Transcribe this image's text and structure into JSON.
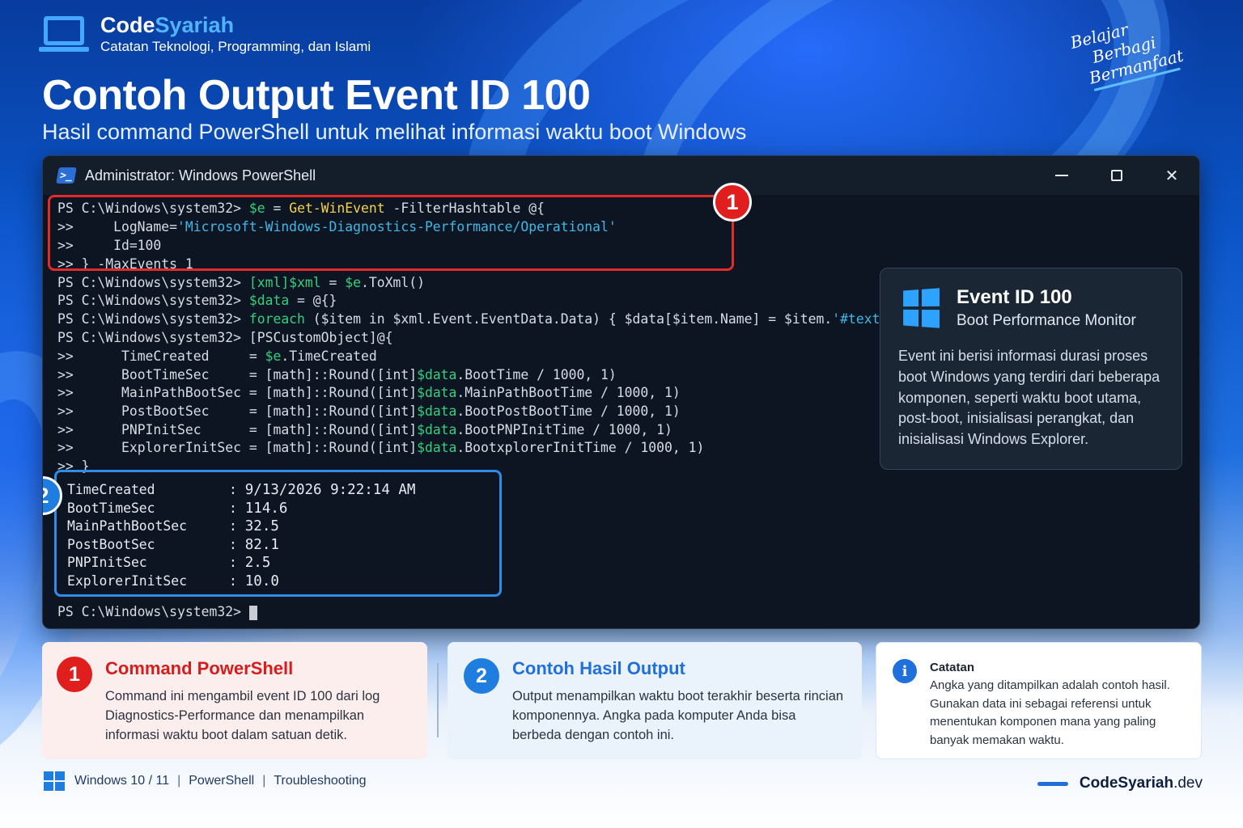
{
  "brand": {
    "name_part1": "Code",
    "name_part2": "Syariah",
    "tagline": "Catatan Teknologi, Programming, dan Islami"
  },
  "motto": [
    "Belajar",
    "Berbagi",
    "Bermanfaat"
  ],
  "title": "Contoh Output Event ID 100",
  "subtitle": "Hasil command PowerShell untuk melihat informasi waktu boot Windows",
  "window": {
    "title": "Administrator: Windows PowerShell",
    "controls": {
      "minimize": "",
      "maximize": "",
      "close": "✕"
    }
  },
  "terminal": {
    "prompt": "PS C:\\Windows\\system32> ",
    "cont": ">> ",
    "lines": [
      {
        "pre": "PS C:\\Windows\\system32> ",
        "parts": [
          [
            "var",
            "$e"
          ],
          [
            "txt",
            " = "
          ],
          [
            "cmd",
            "Get-WinEvent"
          ],
          [
            "txt",
            " -FilterHashtable @{"
          ]
        ]
      },
      {
        "pre": ">>     ",
        "parts": [
          [
            "txt",
            "LogName="
          ],
          [
            "str",
            "'Microsoft-Windows-Diagnostics-Performance/Operational'"
          ]
        ]
      },
      {
        "pre": ">>     ",
        "parts": [
          [
            "txt",
            "Id=100"
          ]
        ]
      },
      {
        "pre": ">> ",
        "parts": [
          [
            "txt",
            "} -MaxEvents 1"
          ]
        ]
      },
      {
        "pre": "PS C:\\Windows\\system32> ",
        "parts": [
          [
            "var",
            "[xml]$xml"
          ],
          [
            "txt",
            " = "
          ],
          [
            "var",
            "$e"
          ],
          [
            "txt",
            ".ToXml()"
          ]
        ]
      },
      {
        "pre": "PS C:\\Windows\\system32> ",
        "parts": [
          [
            "var",
            "$data"
          ],
          [
            "txt",
            " = @{}"
          ]
        ]
      },
      {
        "pre": "PS C:\\Windows\\system32> ",
        "parts": [
          [
            "kw",
            "foreach"
          ],
          [
            "txt",
            " ($item in $xml.Event.EventData.Data) { $data[$item.Name] = $item."
          ],
          [
            "str",
            "'#text'"
          ],
          [
            "txt",
            " }"
          ]
        ]
      },
      {
        "pre": "PS C:\\Windows\\system32> ",
        "parts": [
          [
            "txt",
            "[PSCustomObject]@{"
          ]
        ]
      },
      {
        "pre": ">>      ",
        "parts": [
          [
            "txt",
            "TimeCreated     = "
          ],
          [
            "var",
            "$e"
          ],
          [
            "txt",
            ".TimeCreated"
          ]
        ]
      },
      {
        "pre": ">>      ",
        "parts": [
          [
            "txt",
            "BootTimeSec     = [math]::Round([int]"
          ],
          [
            "var",
            "$data"
          ],
          [
            "txt",
            ".BootTime / 1000, 1)"
          ]
        ]
      },
      {
        "pre": ">>      ",
        "parts": [
          [
            "txt",
            "MainPathBootSec = [math]::Round([int]"
          ],
          [
            "var",
            "$data"
          ],
          [
            "txt",
            ".MainPathBootTime / 1000, 1)"
          ]
        ]
      },
      {
        "pre": ">>      ",
        "parts": [
          [
            "txt",
            "PostBootSec     = [math]::Round([int]"
          ],
          [
            "var",
            "$data"
          ],
          [
            "txt",
            ".BootPostBootTime / 1000, 1)"
          ]
        ]
      },
      {
        "pre": ">>      ",
        "parts": [
          [
            "txt",
            "PNPInitSec      = [math]::Round([int]"
          ],
          [
            "var",
            "$data"
          ],
          [
            "txt",
            ".BootPNPInitTime / 1000, 1)"
          ]
        ]
      },
      {
        "pre": ">>      ",
        "parts": [
          [
            "txt",
            "ExplorerInitSec = [math]::Round([int]"
          ],
          [
            "var",
            "$data"
          ],
          [
            "txt",
            ".BootxplorerInitTime / 1000, 1)"
          ]
        ]
      },
      {
        "pre": ">> ",
        "parts": [
          [
            "txt",
            "}"
          ]
        ]
      }
    ],
    "output": [
      {
        "key": "TimeCreated",
        "value": "9/13/2026 9:22:14 AM"
      },
      {
        "key": "BootTimeSec",
        "value": "114.6"
      },
      {
        "key": "MainPathBootSec",
        "value": "32.5"
      },
      {
        "key": "PostBootSec",
        "value": "82.1"
      },
      {
        "key": "PNPInitSec",
        "value": "2.5"
      },
      {
        "key": "ExplorerInitSec",
        "value": "10.0"
      }
    ],
    "separator": ":",
    "last_prompt": "PS C:\\Windows\\system32> "
  },
  "badges": {
    "one": "1",
    "two": "2"
  },
  "info_card": {
    "title": "Event ID 100",
    "subtitle": "Boot Performance Monitor",
    "body": "Event ini berisi informasi durasi proses boot Windows yang terdiri dari beberapa komponen, seperti waktu boot utama, post-boot, inisialisasi perangkat, dan inisialisasi Windows Explorer."
  },
  "cards": [
    {
      "number": "1",
      "title": "Command PowerShell",
      "body": "Command ini mengambil event ID 100 dari log Diagnostics-Performance dan menampilkan informasi waktu boot dalam satuan detik."
    },
    {
      "number": "2",
      "title": "Contoh Hasil Output",
      "body": "Output menampilkan waktu boot terakhir beserta rincian komponennya. Angka pada komputer Anda bisa berbeda dengan contoh ini."
    }
  ],
  "note": {
    "icon": "i",
    "title": "Catatan",
    "body": "Angka yang ditampilkan adalah contoh hasil. Gunakan data ini sebagai referensi untuk menentukan komponen mana yang paling banyak memakan waktu."
  },
  "footer": {
    "tags": [
      "Windows 10 / 11",
      "PowerShell",
      "Troubleshooting"
    ],
    "pipe": "|",
    "site_name": "CodeSyariah",
    "site_tld": ".dev"
  },
  "colors": {
    "accent_blue": "#1f7de0",
    "accent_red": "#e01e1e",
    "terminal_bg": "#0c1521",
    "var_green": "#35d07f",
    "cmd_yellow": "#f4d24a",
    "string_cyan": "#3fb8e8"
  }
}
